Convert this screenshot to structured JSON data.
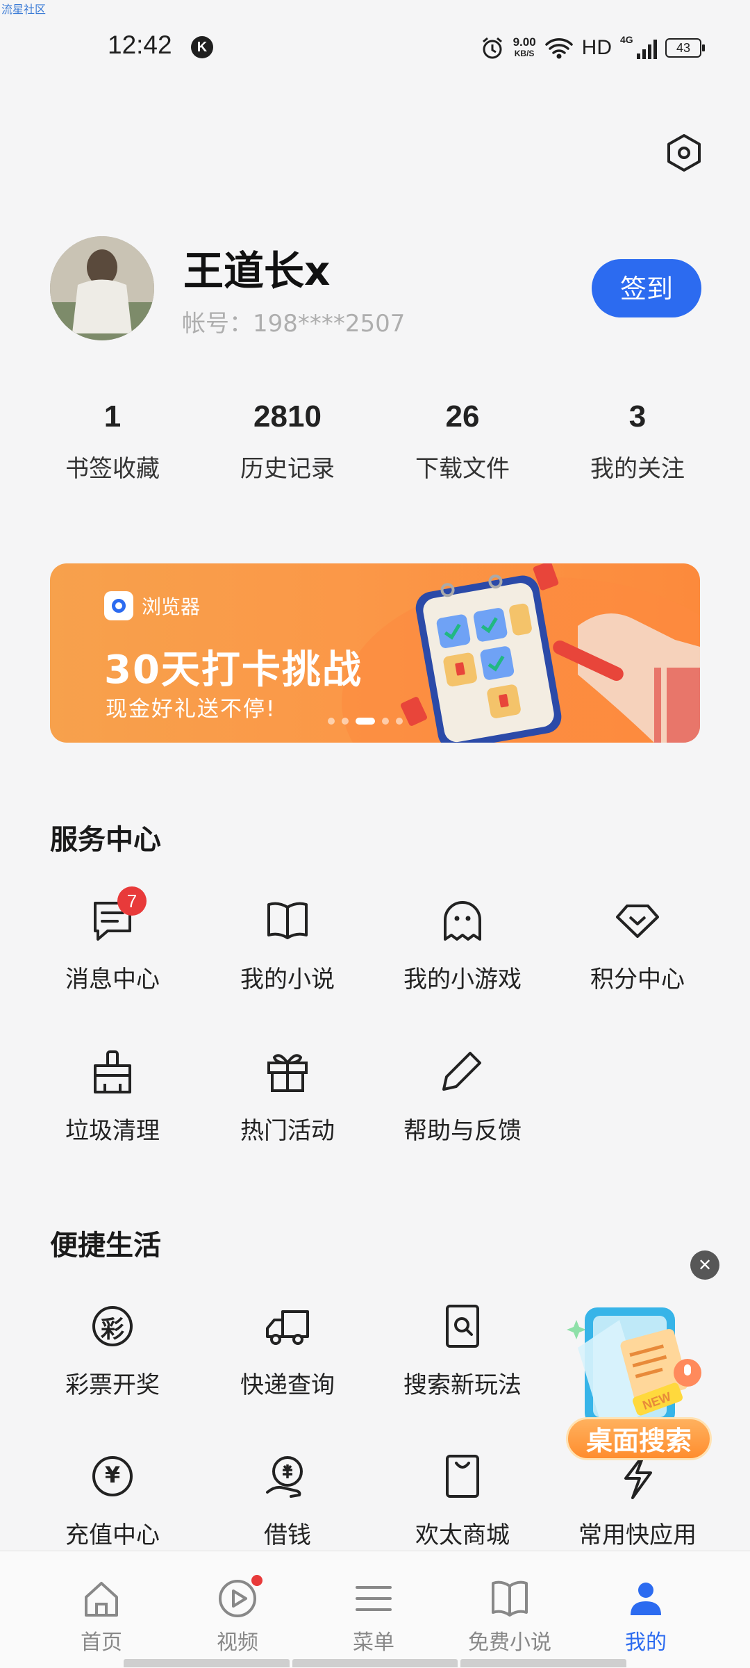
{
  "watermark": "流星社区",
  "status_bar": {
    "time": "12:42",
    "k_badge": "K",
    "net_speed_value": "9.00",
    "net_speed_unit": "KB/S",
    "hd": "HD",
    "network": "4G",
    "battery": "43"
  },
  "profile": {
    "username": "王道长x",
    "account": "帐号：198****2507",
    "checkin_label": "签到"
  },
  "stats": [
    {
      "value": "1",
      "label": "书签收藏"
    },
    {
      "value": "2810",
      "label": "历史记录"
    },
    {
      "value": "26",
      "label": "下载文件"
    },
    {
      "value": "3",
      "label": "我的关注"
    }
  ],
  "banner": {
    "brand": "浏览器",
    "title": "30天打卡挑战",
    "subtitle": "现金好礼送不停!",
    "slide_count": 5,
    "active_slide": 3
  },
  "service_center": {
    "title": "服务中心",
    "items": [
      {
        "label": "消息中心",
        "icon": "message-icon",
        "badge": "7"
      },
      {
        "label": "我的小说",
        "icon": "book-icon"
      },
      {
        "label": "我的小游戏",
        "icon": "ghost-icon"
      },
      {
        "label": "积分中心",
        "icon": "diamond-icon"
      },
      {
        "label": "垃圾清理",
        "icon": "broom-icon"
      },
      {
        "label": "热门活动",
        "icon": "gift-icon"
      },
      {
        "label": "帮助与反馈",
        "icon": "pencil-icon"
      }
    ]
  },
  "convenient_life": {
    "title": "便捷生活",
    "items": [
      {
        "label": "彩票开奖",
        "icon": "lottery-icon",
        "icon_text": "彩"
      },
      {
        "label": "快递查询",
        "icon": "truck-icon"
      },
      {
        "label": "搜索新玩法",
        "icon": "search-doc-icon"
      },
      {
        "label": "充值中心",
        "icon": "yuan-icon",
        "icon_text": "¥"
      },
      {
        "label": "借钱",
        "icon": "loan-icon"
      },
      {
        "label": "欢太商城",
        "icon": "shopping-bag-icon"
      },
      {
        "label": "常用快应用",
        "icon": "lightning-icon"
      }
    ]
  },
  "floating": {
    "close": "✕",
    "label": "桌面搜索",
    "new_tag": "NEW"
  },
  "tabbar": [
    {
      "label": "首页",
      "icon": "home-icon"
    },
    {
      "label": "视频",
      "icon": "video-play-icon",
      "dot": true
    },
    {
      "label": "菜单",
      "icon": "menu-icon"
    },
    {
      "label": "免费小说",
      "icon": "open-book-icon"
    },
    {
      "label": "我的",
      "icon": "person-icon",
      "active": true
    }
  ],
  "colors": {
    "accent": "#2c6bf0",
    "badge": "#e83a3a",
    "banner": "#fb9848",
    "background": "#f5f5f6"
  }
}
